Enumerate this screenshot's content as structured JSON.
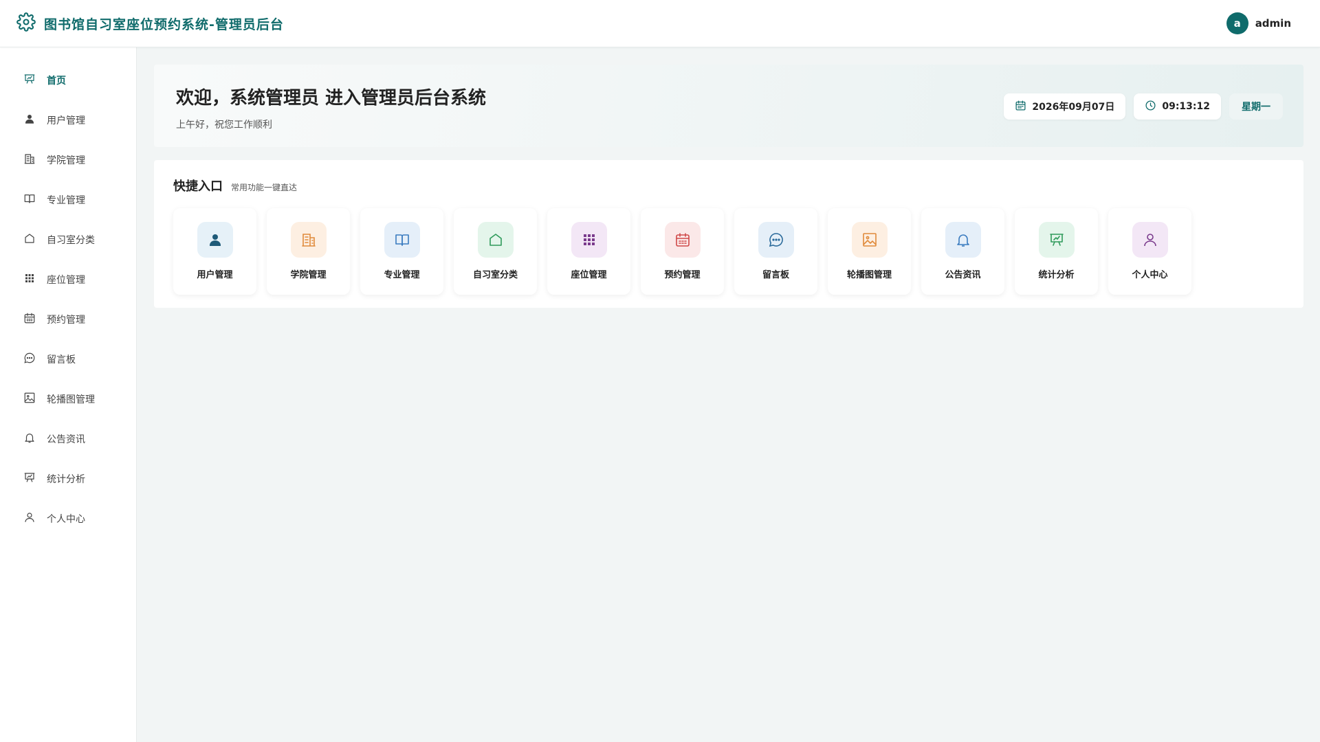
{
  "header": {
    "title": "图书馆自习室座位预约系统-管理员后台",
    "avatar_letter": "a",
    "username": "admin"
  },
  "sidebar": {
    "items": [
      {
        "label": "首页",
        "icon": "presentation-chart-icon",
        "active": true
      },
      {
        "label": "用户管理",
        "icon": "user-icon"
      },
      {
        "label": "学院管理",
        "icon": "building-icon"
      },
      {
        "label": "专业管理",
        "icon": "book-icon"
      },
      {
        "label": "自习室分类",
        "icon": "home-icon"
      },
      {
        "label": "座位管理",
        "icon": "grid-icon"
      },
      {
        "label": "预约管理",
        "icon": "calendar-icon"
      },
      {
        "label": "留言板",
        "icon": "chat-icon"
      },
      {
        "label": "轮播图管理",
        "icon": "image-icon"
      },
      {
        "label": "公告资讯",
        "icon": "bell-icon"
      },
      {
        "label": "统计分析",
        "icon": "presentation-chart-icon"
      },
      {
        "label": "个人中心",
        "icon": "person-outline-icon"
      }
    ]
  },
  "welcome": {
    "title": "欢迎，系统管理员 进入管理员后台系统",
    "subtitle": "上午好，祝您工作顺利",
    "date": "2026年09月07日",
    "time": "09:13:12",
    "weekday": "星期一"
  },
  "quick": {
    "title": "快捷入口",
    "subtitle": "常用功能一键直达",
    "items": [
      {
        "label": "用户管理",
        "icon": "user-icon",
        "color": "#1e5a78",
        "bg": "#e6f1f8"
      },
      {
        "label": "学院管理",
        "icon": "building-icon",
        "color": "#e08a3a",
        "bg": "#fdefe2"
      },
      {
        "label": "专业管理",
        "icon": "book-icon",
        "color": "#3a7bbf",
        "bg": "#e5eff9"
      },
      {
        "label": "自习室分类",
        "icon": "home-icon",
        "color": "#2e9a5a",
        "bg": "#e4f5eb"
      },
      {
        "label": "座位管理",
        "icon": "grid-icon",
        "color": "#7a3a8c",
        "bg": "#f3e7f6"
      },
      {
        "label": "预约管理",
        "icon": "calendar-icon",
        "color": "#d04848",
        "bg": "#fbe8e8"
      },
      {
        "label": "留言板",
        "icon": "chat-icon",
        "color": "#2a6a9a",
        "bg": "#e5eff8"
      },
      {
        "label": "轮播图管理",
        "icon": "image-icon",
        "color": "#e08a3a",
        "bg": "#fdefe2"
      },
      {
        "label": "公告资讯",
        "icon": "bell-icon",
        "color": "#3a7bbf",
        "bg": "#e5eff9"
      },
      {
        "label": "统计分析",
        "icon": "presentation-chart-icon",
        "color": "#2e9a5a",
        "bg": "#e4f5eb"
      },
      {
        "label": "个人中心",
        "icon": "person-outline-icon",
        "color": "#7a3a8c",
        "bg": "#f3e7f6"
      }
    ]
  },
  "colors": {
    "primary": "#0f6b6b",
    "sidebar_icon": "#444444"
  }
}
